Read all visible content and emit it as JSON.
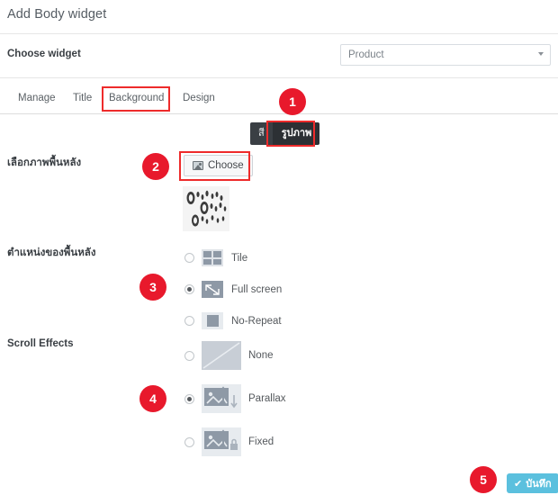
{
  "modal": {
    "title": "Add Body widget"
  },
  "widget_row": {
    "label": "Choose widget",
    "select_value": "Product",
    "caret_icon": "chevron-down-icon"
  },
  "tabs": [
    {
      "label": "Manage",
      "active": false
    },
    {
      "label": "Title",
      "active": false
    },
    {
      "label": "Background",
      "active": true
    },
    {
      "label": "Design",
      "active": false
    }
  ],
  "bg_type_toggle": {
    "options": [
      {
        "label": "สี",
        "active": false
      },
      {
        "label": "รูปภาพ",
        "active": true
      }
    ]
  },
  "background_image": {
    "label": "เลือกภาพพื้นหลัง",
    "choose_button": "Choose",
    "choose_icon": "image-icon",
    "preview_alt": "background-thumbnail"
  },
  "background_position": {
    "label": "ตำแหน่งของพื้นหลัง",
    "options": [
      {
        "label": "Tile",
        "icon": "tile-grid-icon",
        "selected": false
      },
      {
        "label": "Full screen",
        "icon": "diagonal-arrow-icon",
        "selected": true
      },
      {
        "label": "No-Repeat",
        "icon": "single-square-icon",
        "selected": false
      }
    ]
  },
  "scroll_effects": {
    "label": "Scroll Effects",
    "options": [
      {
        "label": "None",
        "icon": "plain-rect-icon",
        "selected": false
      },
      {
        "label": "Parallax",
        "icon": "image-arrow-down-icon",
        "selected": true
      },
      {
        "label": "Fixed",
        "icon": "image-arrow-lock-icon",
        "selected": false
      }
    ]
  },
  "footer": {
    "save_label": "บันทึก",
    "save_icon": "check-icon"
  },
  "annotations": [
    {
      "number": "1"
    },
    {
      "number": "2"
    },
    {
      "number": "3"
    },
    {
      "number": "4"
    },
    {
      "number": "5"
    }
  ],
  "colors": {
    "accent_red": "#e8192c",
    "save_blue": "#5bc0de",
    "toggle_dark": "#3a3f44"
  }
}
